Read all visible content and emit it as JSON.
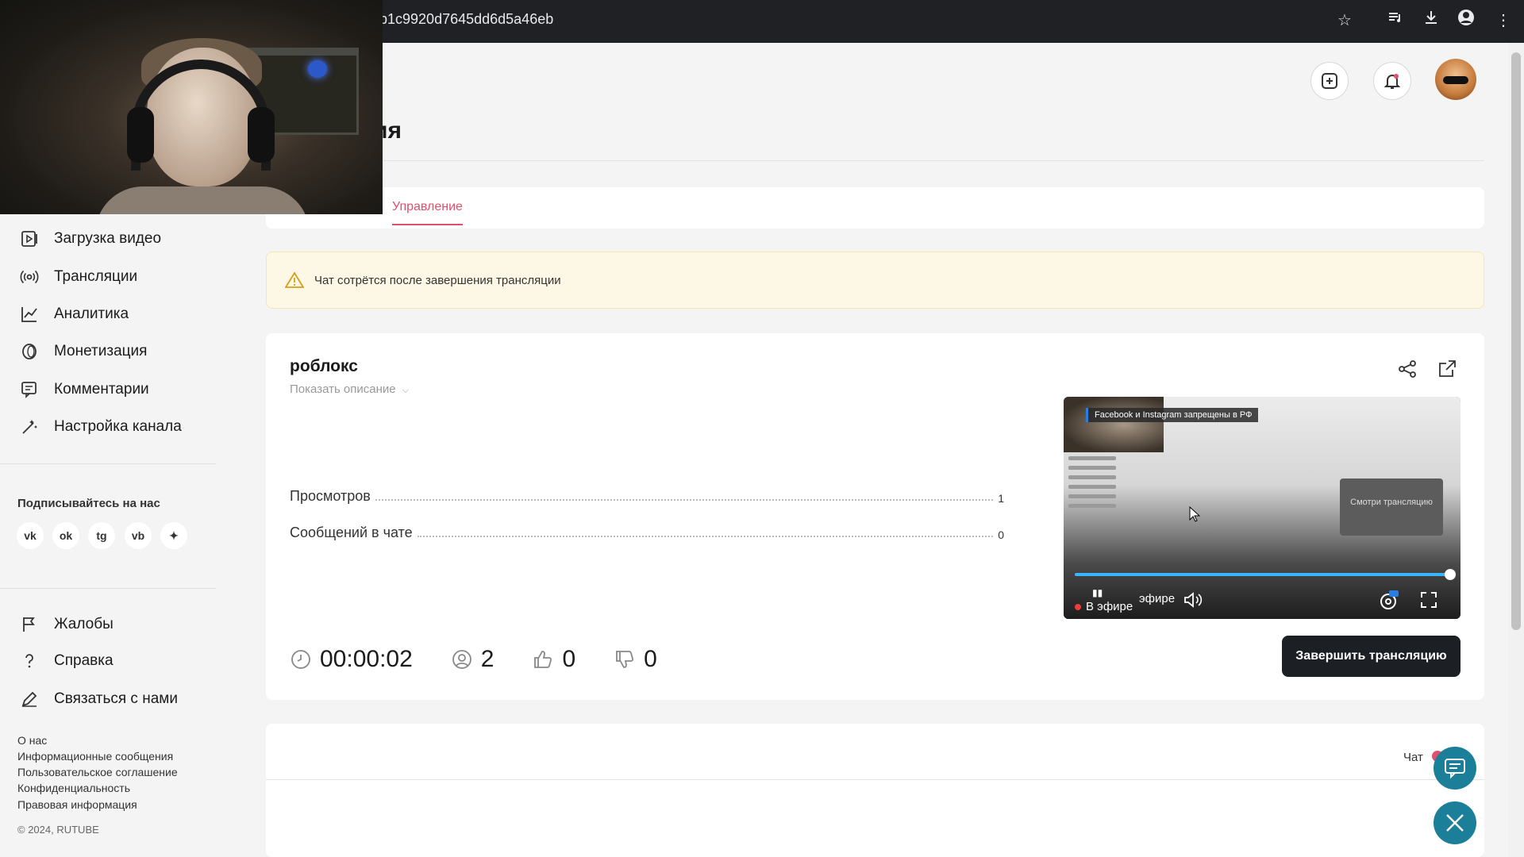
{
  "browser": {
    "url": "b1c9920d7645dd6d5a46eb"
  },
  "page": {
    "title_fragment": "ия",
    "tabs": [
      {
        "label": "Управление",
        "active": true
      }
    ]
  },
  "sidebar": {
    "items": [
      {
        "label": "Загрузка видео",
        "icon": "upload-video-icon"
      },
      {
        "label": "Трансляции",
        "icon": "broadcast-icon"
      },
      {
        "label": "Аналитика",
        "icon": "analytics-icon"
      },
      {
        "label": "Монетизация",
        "icon": "monetization-icon"
      },
      {
        "label": "Комментарии",
        "icon": "comments-icon"
      },
      {
        "label": "Настройка канала",
        "icon": "channel-settings-icon"
      }
    ],
    "follow_title": "Подписывайтесь на нас",
    "socials": [
      {
        "name": "vk",
        "glyph": "vk"
      },
      {
        "name": "odnoklassniki",
        "glyph": "ok"
      },
      {
        "name": "telegram",
        "glyph": "tg"
      },
      {
        "name": "viber",
        "glyph": "vb"
      },
      {
        "name": "other",
        "glyph": "✦"
      }
    ],
    "support_items": [
      {
        "label": "Жалобы",
        "icon": "flag-icon"
      },
      {
        "label": "Справка",
        "icon": "help-icon"
      },
      {
        "label": "Связаться с нами",
        "icon": "contact-icon"
      }
    ],
    "footer_links": [
      "О нас",
      "Информационные сообщения",
      "Пользовательское соглашение",
      "Конфиденциальность",
      "Правовая информация"
    ],
    "copyright": "© 2024, RUTUBE"
  },
  "warning": {
    "text": "Чат сотрётся после завершения трансляции"
  },
  "stream": {
    "title": "роблокс",
    "show_description": "Показать описание",
    "stats": [
      {
        "label": "Просмотров",
        "value": "1"
      },
      {
        "label": "Сообщений в чате",
        "value": "0"
      }
    ],
    "duration": "00:00:02",
    "viewers": "2",
    "likes": "0",
    "dislikes": "0",
    "end_button": "Завершить трансляцию"
  },
  "player": {
    "banner": "Facebook и Instagram запрещены в РФ",
    "mini_box": "Смотри трансляцию",
    "live_label": "В эфире",
    "live_label_partial": "эфире",
    "progress": 1.0,
    "hd_badge": "HD"
  },
  "chat": {
    "label": "Чат"
  },
  "colors": {
    "accent": "#e0506e",
    "dark_button": "#1c2024",
    "fab": "#1c7f99",
    "warning_bg": "#fdf8e6",
    "progress": "#3ab5ff"
  }
}
